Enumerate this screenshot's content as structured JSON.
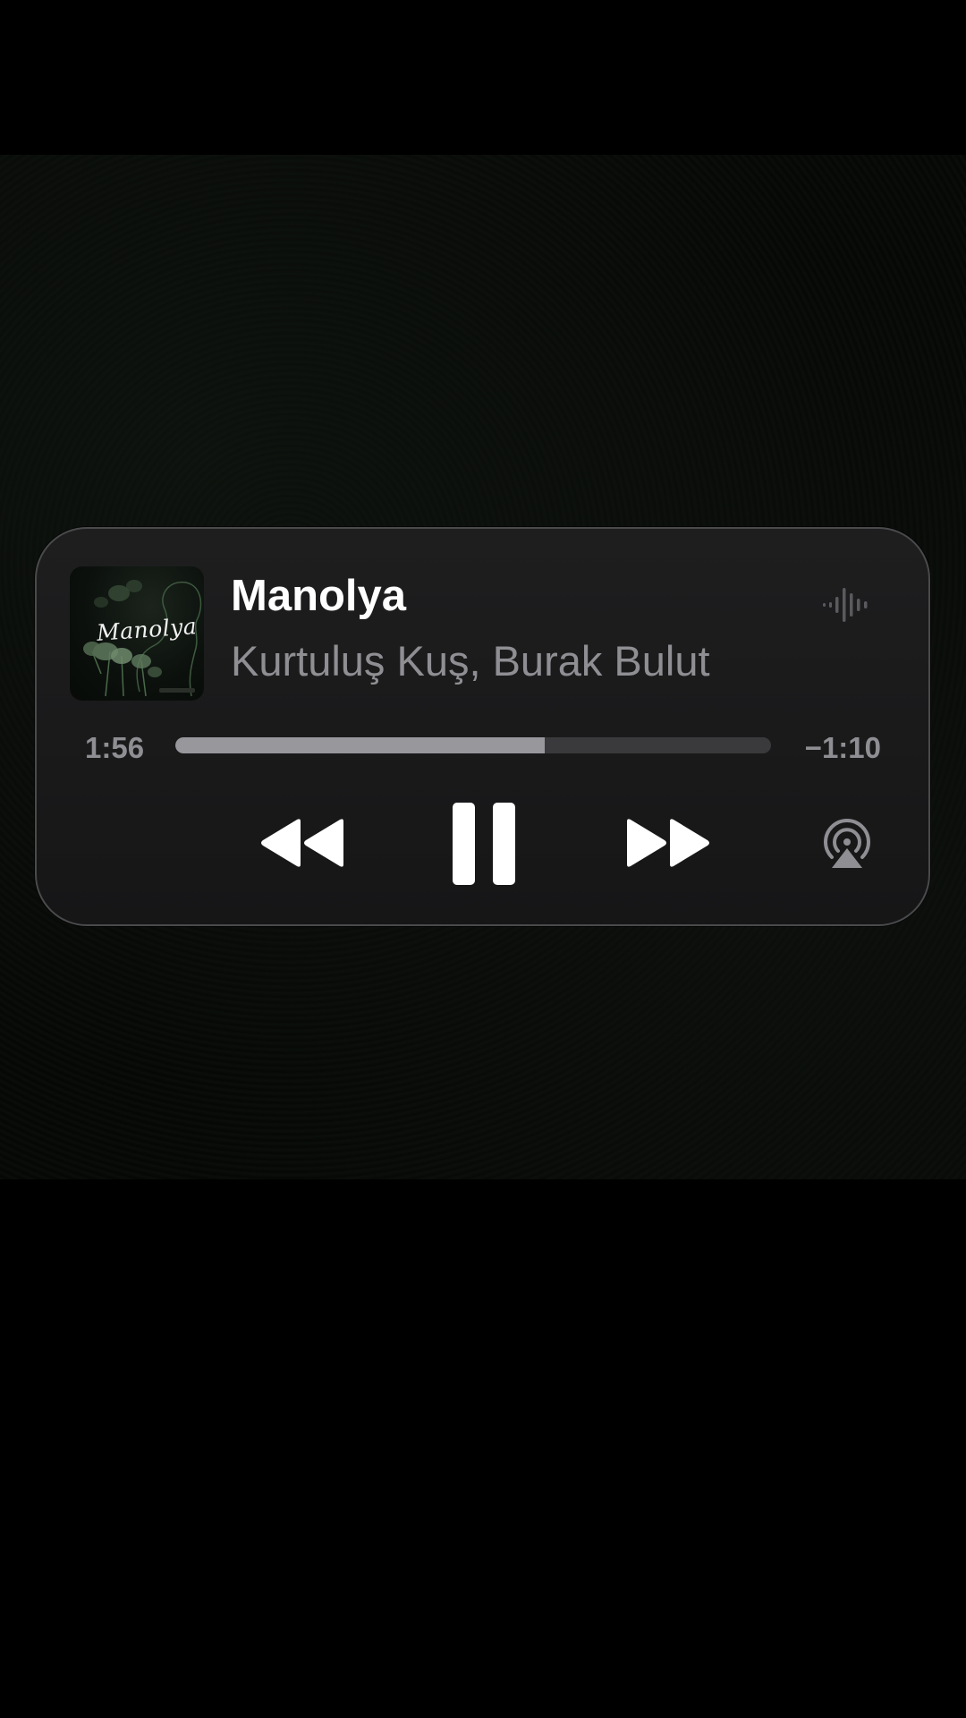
{
  "now_playing": {
    "artwork": {
      "art_text": "Manolya",
      "colors": {
        "background": "#0c110d",
        "leaves": "#5f7a5e"
      }
    },
    "title": "Manolya",
    "artist": "Kurtuluş Kuş, Burak Bulut",
    "elapsed": "1:56",
    "remaining": "−1:10",
    "progress_percent": 62,
    "icons": {
      "waveform": "waveform-icon",
      "rewind": "backward-icon",
      "pause": "pause-icon",
      "forward": "forward-icon",
      "airplay": "airplay-icon"
    }
  },
  "colors": {
    "background": "#000000",
    "card": "#1c1c1e",
    "card_border": "#4a4a4c",
    "title": "#ffffff",
    "secondary_text": "#8e8e93",
    "track_fill": "#98979c",
    "track_empty": "#3a3a3c",
    "controls": "#ffffff"
  }
}
